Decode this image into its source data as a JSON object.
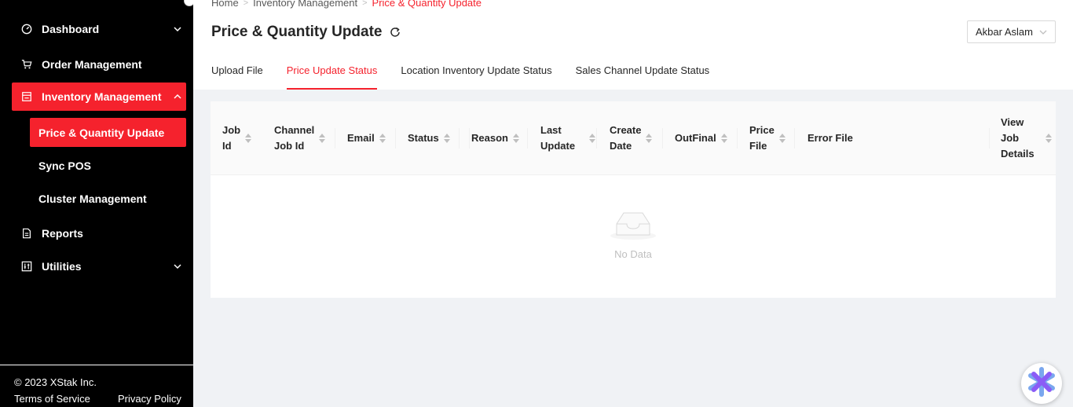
{
  "sidebar": {
    "items": [
      {
        "label": "Dashboard",
        "icon": "dashboard-icon"
      },
      {
        "label": "Order Management",
        "icon": "cart-icon"
      },
      {
        "label": "Inventory Management",
        "icon": "inventory-icon"
      },
      {
        "label": "Reports",
        "icon": "report-icon"
      },
      {
        "label": "Utilities",
        "icon": "utilities-icon"
      }
    ],
    "sub_items": [
      {
        "label": "Price & Quantity Update"
      },
      {
        "label": "Sync POS"
      },
      {
        "label": "Cluster Management"
      }
    ],
    "footer": {
      "copyright": "© 2023 XStak Inc.",
      "terms": "Terms of Service",
      "privacy": "Privacy Policy"
    }
  },
  "breadcrumb": [
    "Home",
    "Inventory Management",
    "Price & Quantity Update"
  ],
  "page_title": "Price & Quantity Update",
  "user": {
    "name": "Akbar Aslam"
  },
  "tabs": [
    {
      "label": "Upload File",
      "active": false
    },
    {
      "label": "Price Update Status",
      "active": true
    },
    {
      "label": "Location Inventory Update Status",
      "active": false
    },
    {
      "label": "Sales Channel Update Status",
      "active": false
    }
  ],
  "table": {
    "columns": [
      {
        "label": "Job\nId",
        "sortable": true
      },
      {
        "label": "Channel\nJob Id",
        "sortable": true
      },
      {
        "label": "Email",
        "sortable": true
      },
      {
        "label": "Status",
        "sortable": true
      },
      {
        "label": "Reason",
        "sortable": true
      },
      {
        "label": "Last\nUpdate",
        "sortable": true
      },
      {
        "label": "Create\nDate",
        "sortable": true
      },
      {
        "label": "OutFinal",
        "sortable": true
      },
      {
        "label": "Price\nFile",
        "sortable": true
      },
      {
        "label": "Error File",
        "sortable": false
      },
      {
        "label": "View\nJob\nDetails",
        "sortable": true
      }
    ],
    "rows": [],
    "empty_text": "No Data"
  },
  "colors": {
    "accent": "#f5222d",
    "sidebar_bg": "#000000",
    "content_bg": "#f0f2f5"
  }
}
